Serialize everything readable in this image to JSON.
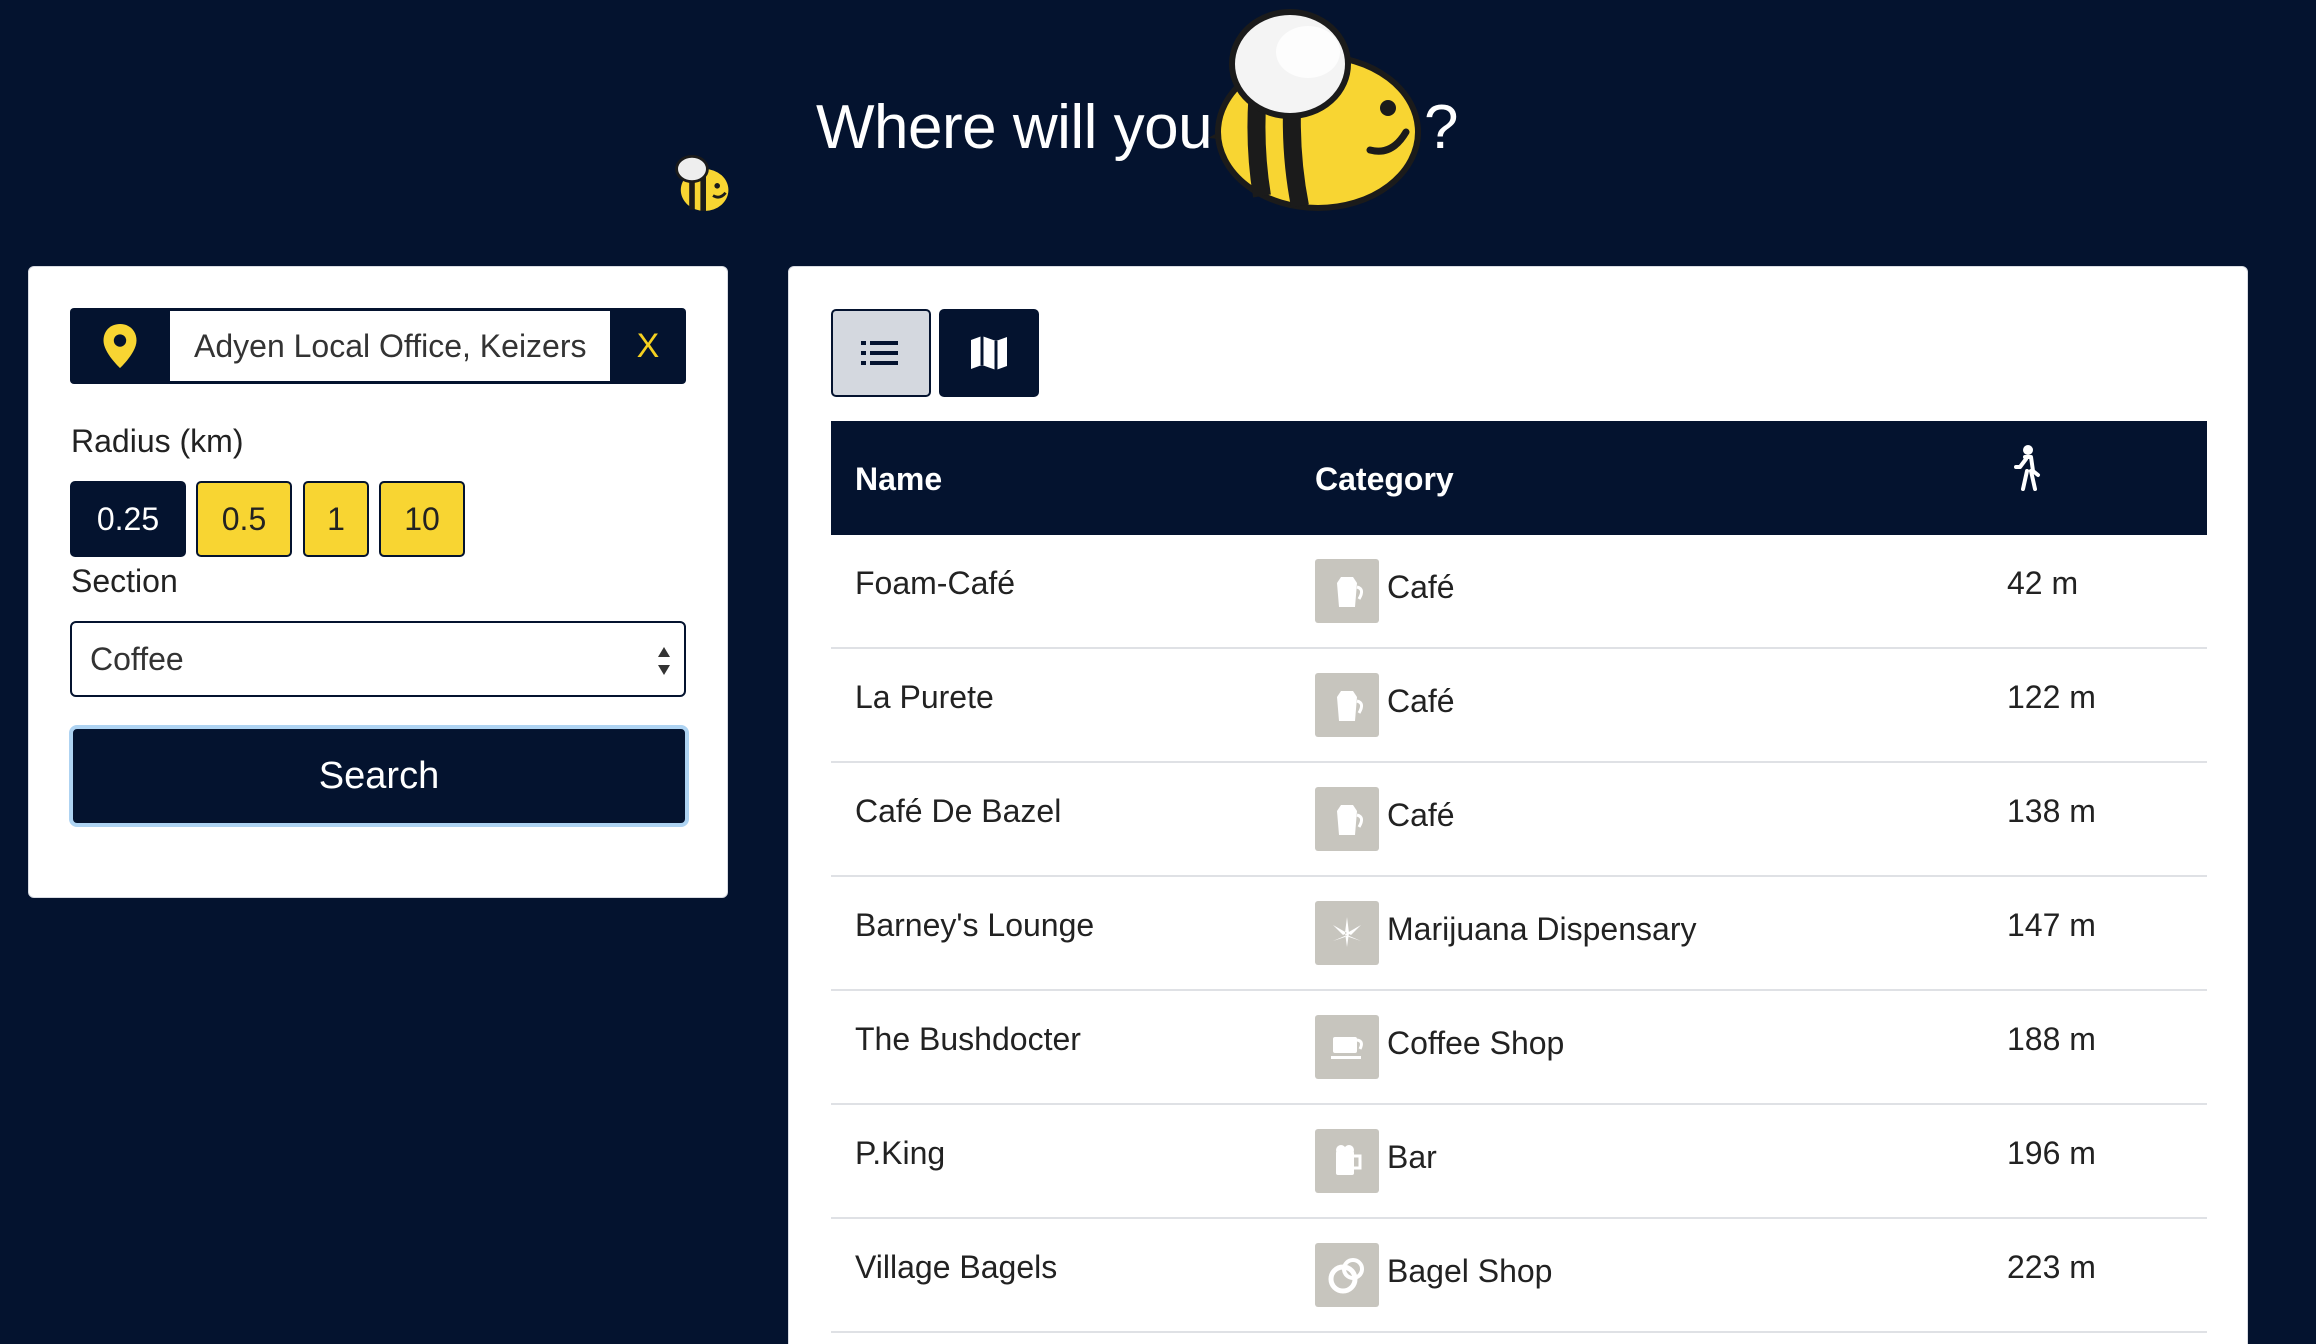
{
  "header": {
    "title": "Where will you",
    "question_mark": "?"
  },
  "search": {
    "location_value": "Adyen Local Office, Keizersgracht",
    "clear_label": "X",
    "radius_label": "Radius (km)",
    "radius_options": [
      "0.25",
      "0.5",
      "1",
      "10"
    ],
    "radius_selected": "0.25",
    "section_label": "Section",
    "section_value": "Coffee",
    "search_label": "Search"
  },
  "results": {
    "columns": {
      "name": "Name",
      "category": "Category"
    },
    "rows": [
      {
        "name": "Foam-Café",
        "category": "Café",
        "icon": "cafe-icon",
        "distance": "42 m"
      },
      {
        "name": "La Purete",
        "category": "Café",
        "icon": "cafe-icon",
        "distance": "122 m"
      },
      {
        "name": "Café De Bazel",
        "category": "Café",
        "icon": "cafe-icon",
        "distance": "138 m"
      },
      {
        "name": "Barney's Lounge",
        "category": "Marijuana Dispensary",
        "icon": "marijuana-icon",
        "distance": "147 m"
      },
      {
        "name": "The Bushdocter",
        "category": "Coffee Shop",
        "icon": "coffee-cup-icon",
        "distance": "188 m"
      },
      {
        "name": "P.King",
        "category": "Bar",
        "icon": "beer-mug-icon",
        "distance": "196 m"
      },
      {
        "name": "Village Bagels",
        "category": "Bagel Shop",
        "icon": "bagel-icon",
        "distance": "223 m"
      }
    ]
  },
  "colors": {
    "navy": "#04132f",
    "yellow": "#f8d532",
    "icon_gray": "#c7c5be"
  }
}
